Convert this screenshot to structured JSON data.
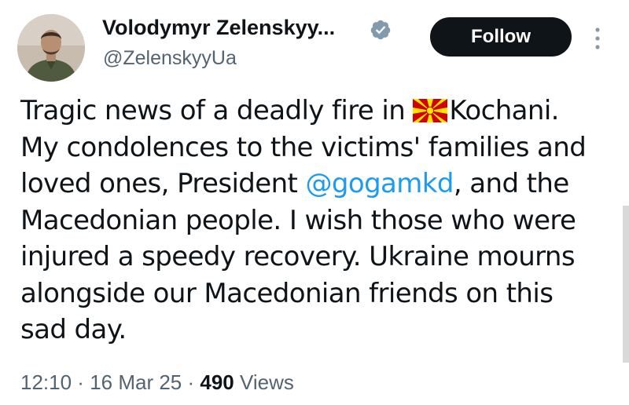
{
  "author": {
    "display_name": "Volodymyr Zelenskyy...",
    "handle": "@ZelenskyyUa",
    "verified": true,
    "avatar": "profile-photo"
  },
  "follow_button": {
    "label": "Follow"
  },
  "more_menu": {
    "icon": "vertical-ellipsis-icon"
  },
  "tweet": {
    "lines": [
      {
        "before_flag": "Tragic news of a deadly fire in ",
        "flag": "north-macedonia-flag",
        "after_flag": "Kochani."
      },
      {
        "text": "My condolences to the victims' families and"
      },
      {
        "before_mention": "loved ones, President ",
        "mention": "@gogamkd",
        "after_mention": ", and the"
      },
      {
        "text": "Macedonian people. I wish those who were"
      },
      {
        "text": "injured a speedy recovery. Ukraine mourns"
      },
      {
        "text": "alongside our Macedonian friends on this"
      },
      {
        "text": "sad day."
      }
    ]
  },
  "meta": {
    "time": "12:10",
    "separator": " · ",
    "date": "16 Mar 25",
    "views_count": "490",
    "views_label": " Views"
  },
  "colors": {
    "text": "#0f1419",
    "secondary": "#536471",
    "link": "#1d9bf0",
    "verified_badge": "#829aab",
    "button_bg": "#0f1419"
  }
}
